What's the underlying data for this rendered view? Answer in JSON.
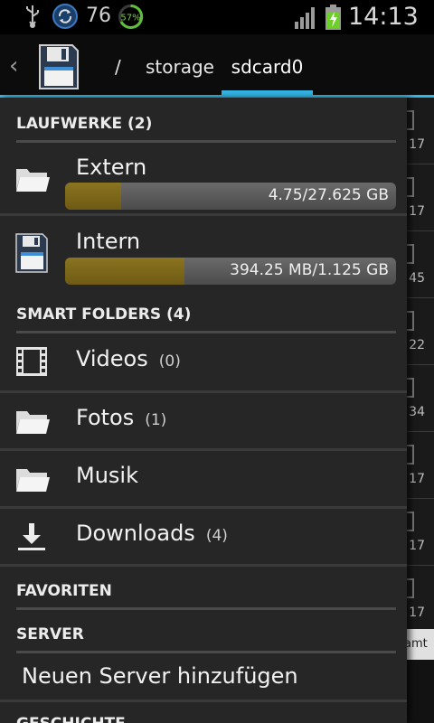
{
  "status_bar": {
    "notification_count": "76",
    "battery_ring_percent": "57%",
    "time": "14:13",
    "icons": [
      "usb-icon",
      "sync-icon",
      "battery-ring-icon",
      "signal-icon",
      "battery-charging-icon"
    ]
  },
  "action_bar": {
    "separator": "/",
    "breadcrumb": [
      "storage",
      "sdcard0"
    ]
  },
  "drawer": {
    "drives_header": "LAUFWERKE (2)",
    "drives": [
      {
        "label": "Extern",
        "usage": "4.75/27.625 GB",
        "fill": 0.17,
        "icon": "folder-icon"
      },
      {
        "label": "Intern",
        "usage": "394.25 MB/1.125 GB",
        "fill": 0.36,
        "icon": "floppy-disk-icon"
      }
    ],
    "smart_header": "SMART FOLDERS (4)",
    "smart": [
      {
        "label": "Videos",
        "count": "(0)",
        "icon": "film-icon"
      },
      {
        "label": "Fotos",
        "count": "(1)",
        "icon": "folder-icon"
      },
      {
        "label": "Musik",
        "count": "",
        "icon": "folder-icon"
      },
      {
        "label": "Downloads",
        "count": "(4)",
        "icon": "download-icon"
      }
    ],
    "favorites_header": "FAVORITEN",
    "server_header": "SERVER",
    "add_server": "Neuen Server hinzufügen",
    "history_header": "GESCHICHTE"
  },
  "background_list": {
    "numbers": [
      "17",
      "17",
      "45",
      "22",
      "34",
      "17",
      "17",
      "17"
    ],
    "tail_text": "amt"
  },
  "colors": {
    "accent": "#33b5e5",
    "drawer_bg": "#262626",
    "bar_fill": "#7d6a1a"
  }
}
